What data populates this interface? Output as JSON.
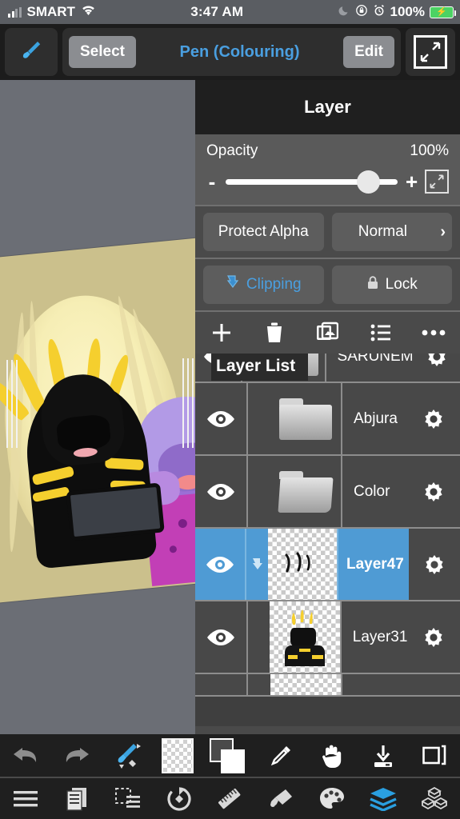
{
  "statusbar": {
    "carrier": "SMART",
    "time": "3:47 AM",
    "battery_pct": "100%",
    "icons": {
      "signal": "signal-bars-icon",
      "wifi": "wifi-icon",
      "dnd": "moon-icon",
      "rotation_lock": "rotation-lock-icon",
      "alarm": "alarm-clock-icon",
      "battery": "battery-charging-icon"
    }
  },
  "toolbar": {
    "brush_icon": "brush-icon",
    "select_label": "Select",
    "pen_label": "Pen (Colouring)",
    "edit_label": "Edit",
    "expand_icon": "expand-icon"
  },
  "panel": {
    "title": "Layer",
    "opacity": {
      "label": "Opacity",
      "value": "100%",
      "minus": "-",
      "plus": "+",
      "expand_icon": "expand-icon"
    },
    "protect_alpha_label": "Protect Alpha",
    "blend_mode_label": "Normal",
    "blend_mode_chevron": "›",
    "clipping_label": "Clipping",
    "lock_label": "Lock",
    "actions": [
      {
        "name": "add-layer",
        "icon": "plus-icon"
      },
      {
        "name": "delete-layer",
        "icon": "trash-icon"
      },
      {
        "name": "duplicate-layer",
        "icon": "image-copy-icon"
      },
      {
        "name": "layer-options-list",
        "icon": "list-icon"
      },
      {
        "name": "more-options",
        "icon": "ellipsis-icon"
      }
    ]
  },
  "layer_list": {
    "tooltip": "Layer List",
    "rows": [
      {
        "name": "SARUNEM",
        "type": "page",
        "visible": true,
        "selected": false,
        "clipping": false
      },
      {
        "name": "Abjura",
        "type": "folder-closed",
        "visible": true,
        "selected": false,
        "clipping": false
      },
      {
        "name": "Color",
        "type": "folder-open",
        "visible": true,
        "selected": false,
        "clipping": false
      },
      {
        "name": "Layer47",
        "type": "transparent",
        "visible": true,
        "selected": true,
        "clipping": true
      },
      {
        "name": "Layer31",
        "type": "artwork",
        "visible": true,
        "selected": false,
        "clipping": false
      }
    ]
  },
  "tool_row": [
    {
      "name": "undo-button",
      "icon": "undo-icon"
    },
    {
      "name": "redo-button",
      "icon": "redo-icon"
    },
    {
      "name": "brush-eraser-toggle",
      "icon": "brush-eraser-icon"
    },
    {
      "name": "transparency-swatch",
      "icon": "transparent-swatch-icon"
    },
    {
      "name": "color-swatch",
      "icon": "color-swatch-icon"
    },
    {
      "name": "eyedropper-tool",
      "icon": "eyedropper-icon"
    },
    {
      "name": "hand-tool",
      "icon": "hand-icon"
    },
    {
      "name": "fill-down-tool",
      "icon": "download-icon"
    },
    {
      "name": "duplicate-tool",
      "icon": "copy-frame-icon"
    }
  ],
  "nav_row": [
    {
      "name": "menu-button",
      "icon": "hamburger-icon",
      "active": false
    },
    {
      "name": "pages-button",
      "icon": "pages-icon",
      "active": false
    },
    {
      "name": "selection-button",
      "icon": "selection-icon",
      "active": false
    },
    {
      "name": "rotate-button",
      "icon": "rotate-icon",
      "active": false
    },
    {
      "name": "ruler-button",
      "icon": "ruler-icon",
      "active": false
    },
    {
      "name": "bucket-button",
      "icon": "bucket-fill-icon",
      "active": false
    },
    {
      "name": "palette-button",
      "icon": "palette-icon",
      "active": false
    },
    {
      "name": "layers-button",
      "icon": "layers-icon",
      "active": true
    },
    {
      "name": "materials-button",
      "icon": "cubes-icon",
      "active": false
    }
  ],
  "colors": {
    "accent_blue": "#4a9fe0",
    "selected_row": "#4f9bd4",
    "panel_bg": "#4a4a4a",
    "workspace_bg": "#6b6e75",
    "battery_green": "#4cd263"
  }
}
